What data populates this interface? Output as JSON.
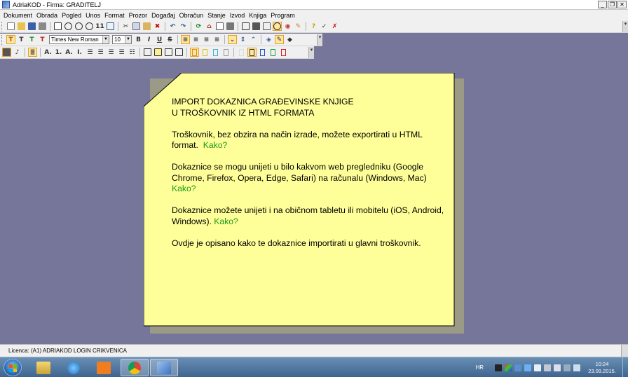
{
  "window": {
    "title": "AdriaKOD - Firma: GRADITELJ",
    "buttons": [
      "_",
      "❐",
      "✕"
    ]
  },
  "menu": [
    "Dokument",
    "Obrada",
    "Pogled",
    "Unos",
    "Format",
    "Prozor",
    "Događaj",
    "Obračun",
    "Stanje",
    "Izvod",
    "Knjiga",
    "Program"
  ],
  "toolbar2": {
    "font": "Times New Roman",
    "size": "10",
    "bold": "B",
    "italic": "I",
    "underline": "U",
    "strike": "S",
    "style_labels": [
      "T",
      "T",
      "T",
      "T"
    ]
  },
  "toolbar3": {
    "list_labels": [
      "A.",
      "1.",
      "A.",
      "I."
    ]
  },
  "note": {
    "title_line1": "IMPORT DOKAZNICA GRAĐEVINSKE KNJIGE",
    "title_line2": "U TROŠKOVNIK IZ HTML FORMATA",
    "p1": "Troškovnik, bez obzira na način izrade, možete exportirati u HTML format.",
    "p1_link": "Kako?",
    "p2": "Dokaznice se mogu unijeti u bilo kakvom web pregledniku (Google Chrome, Firefox, Opera, Edge, Safari) na računalu (Windows, Mac)",
    "p2_link": "Kako?",
    "p3": "Dokaznice možete unijeti i na običnom tabletu ili mobitelu (iOS, Android, Windows).",
    "p3_link": "Kako?",
    "p4": "Ovdje je opisano kako te dokaznice importirati u glavni troškovnik."
  },
  "status": {
    "text": "Licenca: (A1) ADRIAKOD LOGIN CRIKVENICA"
  },
  "taskbar": {
    "apps": [
      "explorer-icon",
      "internet-explorer-icon",
      "media-player-icon",
      "chrome-icon",
      "adriakod-icon"
    ],
    "lang": "HR",
    "time": "10:24",
    "date": "23.09.2015."
  },
  "colors": {
    "desktop_bg": "#76759a",
    "note_bg": "#ffff99",
    "link": "#1a9a1a"
  }
}
